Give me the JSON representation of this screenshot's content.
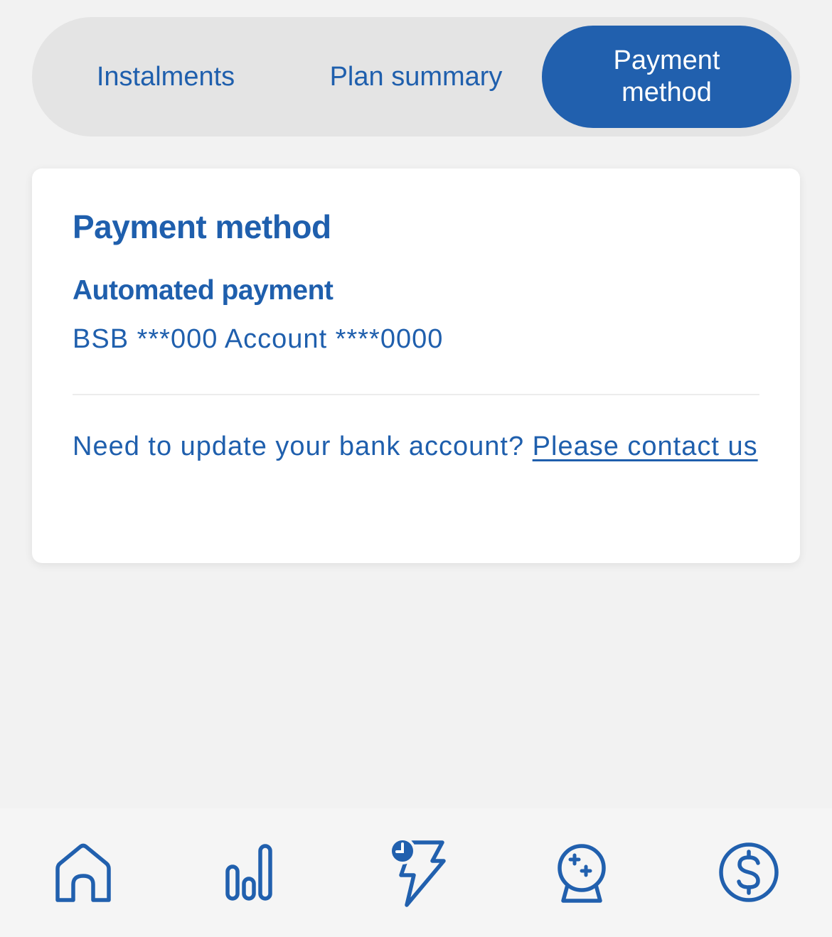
{
  "tabs": [
    {
      "label": "Instalments",
      "active": false
    },
    {
      "label": "Plan summary",
      "active": false
    },
    {
      "label": "Payment method",
      "active": true
    }
  ],
  "card": {
    "title": "Payment method",
    "method_title": "Automated payment",
    "account_details": "BSB ***000 Account ****0000",
    "update_prompt": "Need to update your bank account? ",
    "contact_link": "Please contact us"
  },
  "bottom_nav": [
    {
      "icon": "home-icon"
    },
    {
      "icon": "bar-chart-icon"
    },
    {
      "icon": "lightning-clock-icon"
    },
    {
      "icon": "crystal-ball-icon"
    },
    {
      "icon": "dollar-circle-icon"
    }
  ],
  "colors": {
    "brand_blue": "#2160ae",
    "text_blue": "#1f5fad",
    "tabs_bg": "#e4e4e4",
    "page_bg": "#f2f2f2"
  }
}
